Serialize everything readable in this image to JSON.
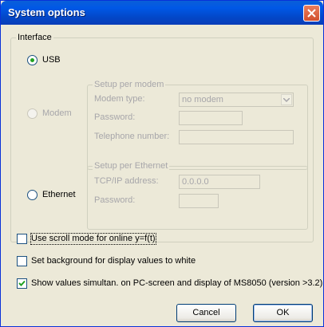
{
  "window": {
    "title": "System options"
  },
  "interface": {
    "legend": "Interface",
    "usb_label": "USB",
    "modem_label": "Modem",
    "ethernet_label": "Ethernet",
    "selected": "USB"
  },
  "modem_setup": {
    "legend": "Setup per modem",
    "modem_type_label": "Modem type:",
    "modem_type_value": "no modem",
    "password_label": "Password:",
    "password_value": "",
    "phone_label": "Telephone number:",
    "phone_value": ""
  },
  "ethernet_setup": {
    "legend": "Setup per Ethernet",
    "ip_label": "TCP/IP address:",
    "ip_value": "0.0.0.0",
    "password_label": "Password:",
    "password_value": ""
  },
  "options": {
    "scroll_mode_label": "Use scroll mode for online y=f(t)",
    "scroll_mode_checked": false,
    "background_label": "Set background for display values to white",
    "background_checked": false,
    "simultan_label": "Show values simultan. on PC-screen and display of MS8050 (version >3.2)",
    "simultan_checked": true
  },
  "buttons": {
    "cancel": "Cancel",
    "ok": "OK"
  },
  "colors": {
    "title_bar": "#0058e6",
    "close_button": "#d2502e",
    "dialog_bg": "#ece9d8",
    "radio_dot": "#21a121"
  }
}
